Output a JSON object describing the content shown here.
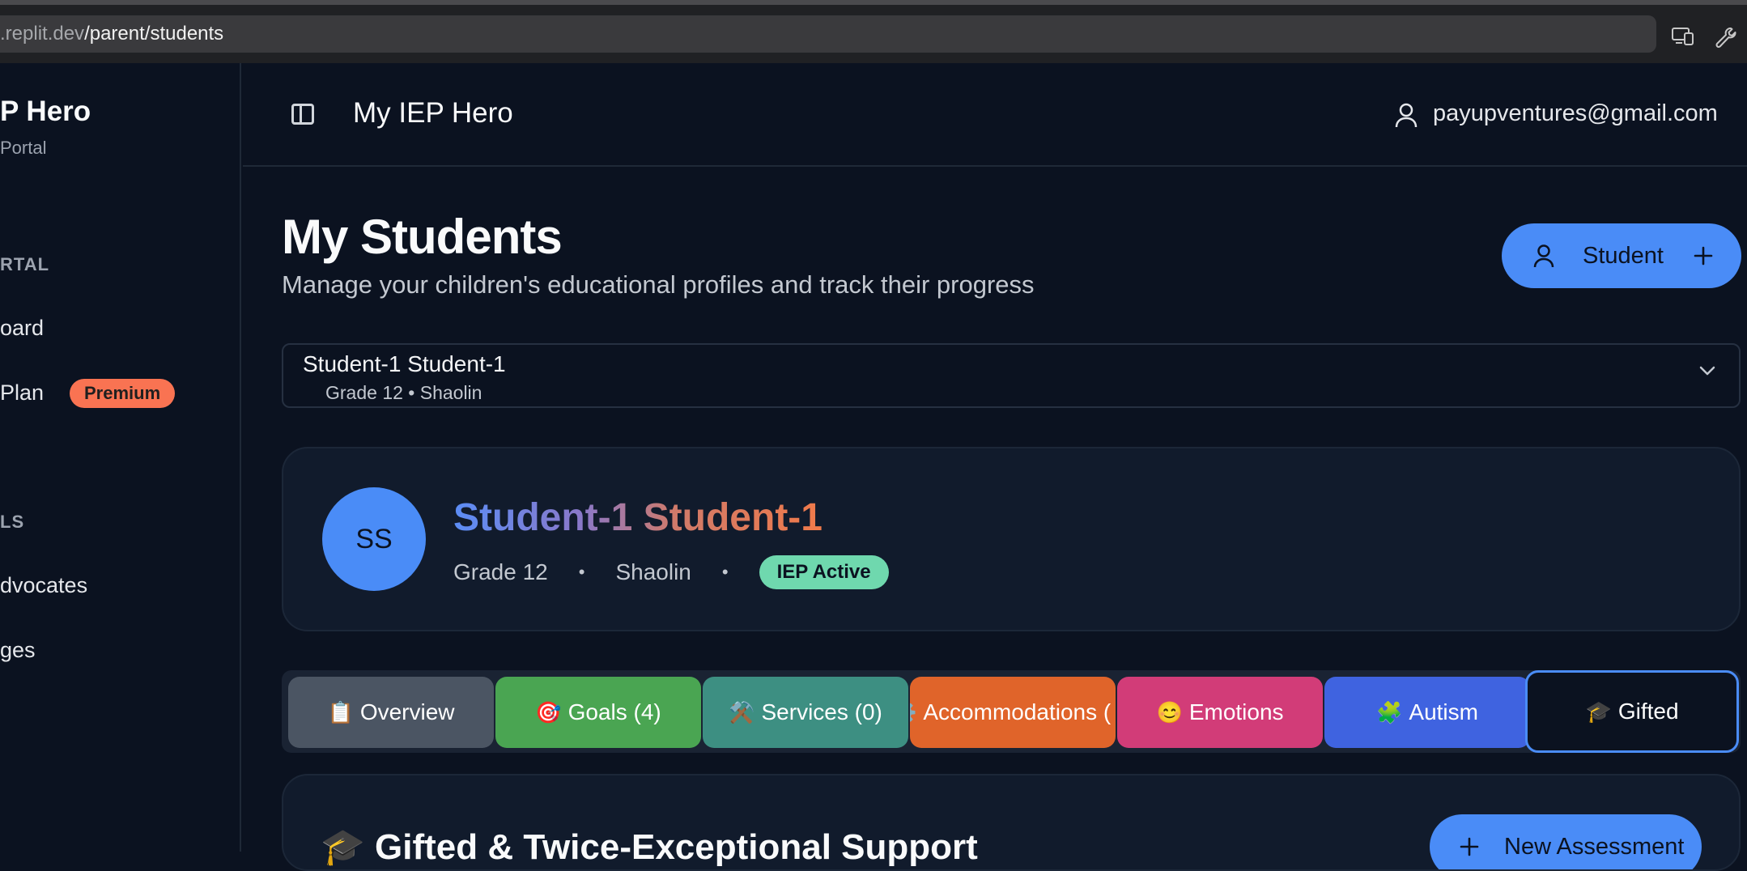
{
  "browser": {
    "url_host": ".replit.dev",
    "url_path": "/parent/students",
    "icons": [
      "responsive-view-icon",
      "wrench-icon"
    ]
  },
  "sidebar": {
    "title": "P Hero",
    "subtitle": "Portal",
    "section_portal": "RTAL",
    "items": [
      {
        "label": "oard"
      },
      {
        "label": "Plan",
        "badge": "Premium"
      }
    ],
    "section_tools": "LS",
    "tool_items": [
      {
        "label": "dvocates"
      },
      {
        "label": "ges"
      }
    ]
  },
  "header": {
    "title": "My IEP Hero",
    "user_email": "payupventures@gmail.com"
  },
  "page": {
    "title": "My Students",
    "subtitle": "Manage your children's educational profiles and track their progress",
    "add_button": "Student"
  },
  "selector": {
    "name": "Student-1 Student-1",
    "meta": "Grade 12 • Shaolin"
  },
  "profile": {
    "initials": "SS",
    "name": "Student-1 Student-1",
    "grade": "Grade 12",
    "school": "Shaolin",
    "separator": "•",
    "status": "IEP Active"
  },
  "tabs": [
    {
      "emoji": "📋",
      "label": "Overview",
      "color": "#4b5563"
    },
    {
      "emoji": "🎯",
      "label": "Goals (4)",
      "color": "#4aa552"
    },
    {
      "emoji": "⚒️",
      "label": "Services (0)",
      "color": "#3d8f82"
    },
    {
      "emoji": "⚙️",
      "label": "Accommodations (",
      "color": "#e0642a"
    },
    {
      "emoji": "😊",
      "label": "Emotions",
      "color": "#d23c78"
    },
    {
      "emoji": "🧩",
      "label": "Autism",
      "color": "#3f63e0"
    },
    {
      "emoji": "🎓",
      "label": "Gifted",
      "color": "#0b1220",
      "active": true
    }
  ],
  "section": {
    "title": "🎓 Gifted & Twice-Exceptional Support",
    "new_button": "New Assessment"
  },
  "colors": {
    "accent": "#4a8cf7",
    "premium": "#f97352",
    "iep_active": "#6fd8ae"
  }
}
